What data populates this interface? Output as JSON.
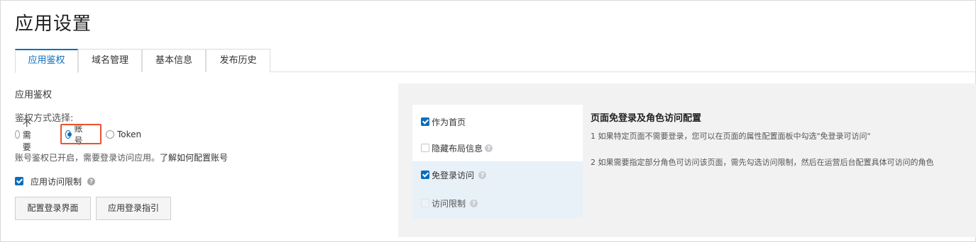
{
  "page": {
    "title": "应用设置"
  },
  "tabs": [
    {
      "label": "应用鉴权",
      "active": true
    },
    {
      "label": "域名管理",
      "active": false
    },
    {
      "label": "基本信息",
      "active": false
    },
    {
      "label": "发布历史",
      "active": false
    }
  ],
  "auth": {
    "section_title": "应用鉴权",
    "method_label": "鉴权方式选择:",
    "options": [
      {
        "label": "不需要",
        "checked": false
      },
      {
        "label": "账号",
        "checked": true
      },
      {
        "label": "Token",
        "checked": false
      }
    ],
    "tip": "账号鉴权已开启，需要登录访问应用。",
    "tip_link": "了解如何配置账号",
    "access_limit": {
      "label": "应用访问限制",
      "checked": true,
      "help_icon": "question-circle-icon"
    },
    "buttons": {
      "config_login": "配置登录界面",
      "login_guide": "应用登录指引"
    },
    "highlight_color": "#e8542e"
  },
  "preview": {
    "menu": [
      {
        "label": "作为首页",
        "state": "checked",
        "help": false,
        "selected": false
      },
      {
        "label": "隐藏布局信息",
        "state": "unchecked",
        "help": true,
        "selected": false
      },
      {
        "label": "免登录访问",
        "state": "checked",
        "help": true,
        "selected": true
      },
      {
        "label": "访问限制",
        "state": "disabled",
        "help": true,
        "selected": true
      }
    ],
    "title": "页面免登录及角色访问配置",
    "lines": [
      "1 如果特定页面不需要登录，您可以在页面的属性配置面板中勾选\"免登录可访问\"",
      "2 如果需要指定部分角色可访问该页面，需先勾选访问限制，然后在运营后台配置具体可访问的角色"
    ]
  },
  "colors": {
    "primary": "#0a6ebd",
    "highlight": "#e8542e"
  }
}
